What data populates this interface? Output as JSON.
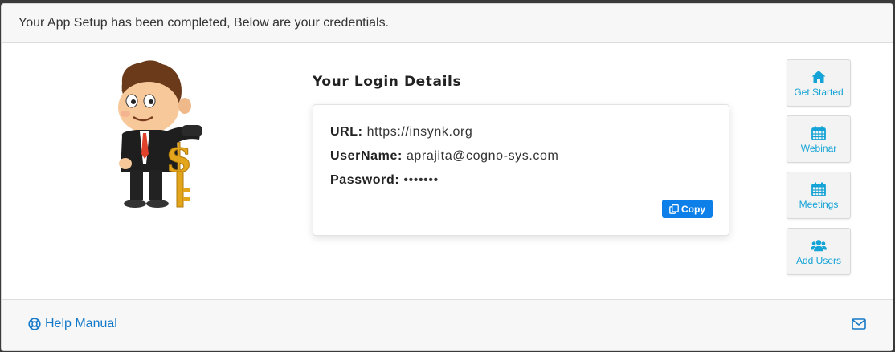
{
  "header": {
    "message": "Your App Setup has been completed, Below are your credentials."
  },
  "login": {
    "title": "Your Login Details",
    "url_label": "URL:",
    "url_value": "https://insynk.org",
    "username_label": "UserName:",
    "username_value": "aprajita@cogno-sys.com",
    "password_label": "Password:",
    "password_value": "•••••••",
    "copy_label": "Copy"
  },
  "side_buttons": [
    {
      "label": "Get Started",
      "icon": "home-icon"
    },
    {
      "label": "Webinar",
      "icon": "calendar-icon"
    },
    {
      "label": "Meetings",
      "icon": "calendar-icon"
    },
    {
      "label": "Add Users",
      "icon": "users-icon"
    }
  ],
  "footer": {
    "help_label": "Help Manual",
    "help_icon": "life-ring-icon",
    "mail_icon": "envelope-icon"
  },
  "colors": {
    "accent_blue": "#0d7fe8",
    "side_button_text": "#14a3d6",
    "link": "#1479c9"
  }
}
